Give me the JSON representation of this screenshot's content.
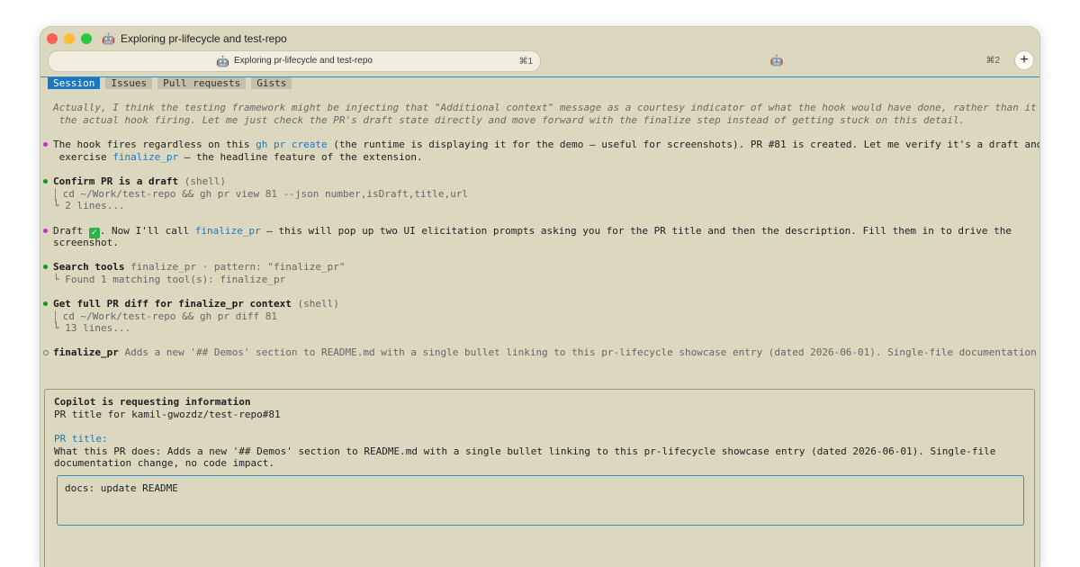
{
  "window": {
    "title": "Exploring pr-lifecycle and test-repo",
    "title_icon": "robot-icon"
  },
  "tabs": [
    {
      "label": "Exploring pr-lifecycle and test-repo",
      "shortcut": "⌘1",
      "active": true
    },
    {
      "label": "",
      "shortcut": "⌘2",
      "active": false
    }
  ],
  "new_tab_label": "+",
  "nav": {
    "items": [
      "Session",
      "Issues",
      "Pull requests",
      "Gists"
    ],
    "active": "Session"
  },
  "transcript": {
    "italic_note": [
      "Actually, I think the testing framework might be injecting that \"Additional context\" message as a courtesy indicator of what the hook would have done, rather than it being",
      " the actual hook firing. Let me just check the PR's draft state directly and move forward with the finalize step instead of getting stuck on this detail."
    ],
    "msg1": {
      "a": "The hook fires regardless on this ",
      "link1": "gh pr create",
      "b": " (the runtime is displaying it for the demo — useful for screenshots). PR #81 is created. Let me verify it's a draft and then",
      "c": " exercise ",
      "link2": "finalize_pr",
      "d": " — the headline feature of the extension."
    },
    "tool1": {
      "title": "Confirm PR is a draft",
      "kind": " (shell)",
      "cmd": " cd ~/Work/test-repo && gh pr view 81 --json number,isDraft,title,url",
      "summary": "└ 2 lines..."
    },
    "msg2": {
      "a": "Draft ",
      "check": "✓",
      "b": ". Now I'll call ",
      "link": "finalize_pr",
      "c": " — this will pop up two UI elicitation prompts asking you for the PR title and then the description. Fill them in to drive the",
      "d": "screenshot."
    },
    "tool2": {
      "title": "Search tools",
      "args": " finalize_pr · pattern: \"finalize_pr\"",
      "summary": "└ Found 1 matching tool(s): finalize_pr"
    },
    "tool3": {
      "title": "Get full PR diff for finalize_pr context",
      "kind": " (shell)",
      "cmd": " cd ~/Work/test-repo && gh pr diff 81",
      "summary": "└ 13 lines..."
    },
    "tool4": {
      "title": "finalize_pr",
      "args": " Adds a new '## Demos' section to README.md with a single bullet linking to this pr-lifecycle showcase entry (dated 2026-06-01). Single-file documentation chan…"
    }
  },
  "prompt": {
    "header": "Copilot is requesting information",
    "subtitle": "PR title for kamil-gwozdz/test-repo#81",
    "field_label": "PR title:",
    "description_1": "What this PR does: Adds a new '## Demos' section to README.md with a single bullet linking to this pr-lifecycle showcase entry (dated 2026-06-01). Single-file",
    "description_2": "documentation change, no code impact.",
    "input_value": "docs: update README"
  }
}
